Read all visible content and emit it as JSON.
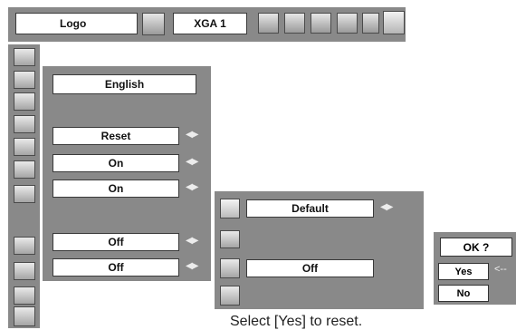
{
  "toolbar": {
    "logo_label": "Logo",
    "source_label": "XGA 1"
  },
  "main_menu": {
    "language_value": "English",
    "reset_value": "Reset",
    "setting_a_value": "On",
    "setting_b_value": "On",
    "setting_c_value": "Off",
    "setting_d_value": "Off",
    "arrows": "◀▶"
  },
  "submenu": {
    "default_value": "Default",
    "off_value": "Off",
    "arrows": "◀▶"
  },
  "confirm_dialog": {
    "title": "OK ?",
    "yes_label": "Yes",
    "no_label": "No",
    "pointer": "<--"
  },
  "footer_text": "Select [Yes] to reset."
}
